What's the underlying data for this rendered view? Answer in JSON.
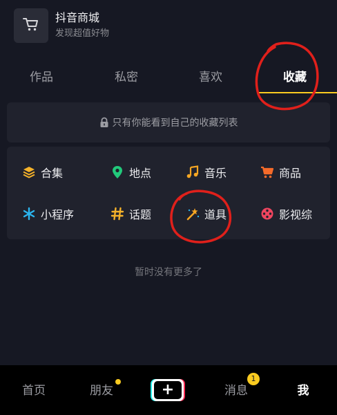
{
  "shop": {
    "title": "抖音商城",
    "subtitle": "发现超值好物",
    "icon": "cart-icon"
  },
  "tabs": [
    {
      "label": "作品",
      "active": false
    },
    {
      "label": "私密",
      "active": false
    },
    {
      "label": "喜欢",
      "active": false
    },
    {
      "label": "收藏",
      "active": true
    }
  ],
  "notice": {
    "icon": "lock-icon",
    "text": "只有你能看到自己的收藏列表"
  },
  "categories": [
    {
      "label": "合集",
      "icon": "layers-icon",
      "color": "#f5b22a"
    },
    {
      "label": "地点",
      "icon": "location-pin-icon",
      "color": "#22c97b"
    },
    {
      "label": "音乐",
      "icon": "music-note-icon",
      "color": "#f5a623"
    },
    {
      "label": "商品",
      "icon": "shopping-cart-icon",
      "color": "#f56b2a"
    },
    {
      "label": "小程序",
      "icon": "mini-program-icon",
      "color": "#2bb6f0"
    },
    {
      "label": "话题",
      "icon": "hashtag-icon",
      "color": "#f5b22a"
    },
    {
      "label": "道具",
      "icon": "magic-wand-icon",
      "color": "#f5a623"
    },
    {
      "label": "影视综",
      "icon": "film-reel-icon",
      "color": "#f0455f"
    }
  ],
  "empty_text": "暂时没有更多了",
  "bottom_nav": {
    "items": [
      {
        "label": "首页",
        "active": false
      },
      {
        "label": "朋友",
        "active": false,
        "has_dot": true
      },
      {
        "label": "消息",
        "active": false,
        "badge": "1"
      },
      {
        "label": "我",
        "active": true
      }
    ],
    "add_label": "+"
  },
  "colors": {
    "background": "#161823",
    "card": "#20222d",
    "accent": "#facb20",
    "annotation": "#e0201b"
  }
}
